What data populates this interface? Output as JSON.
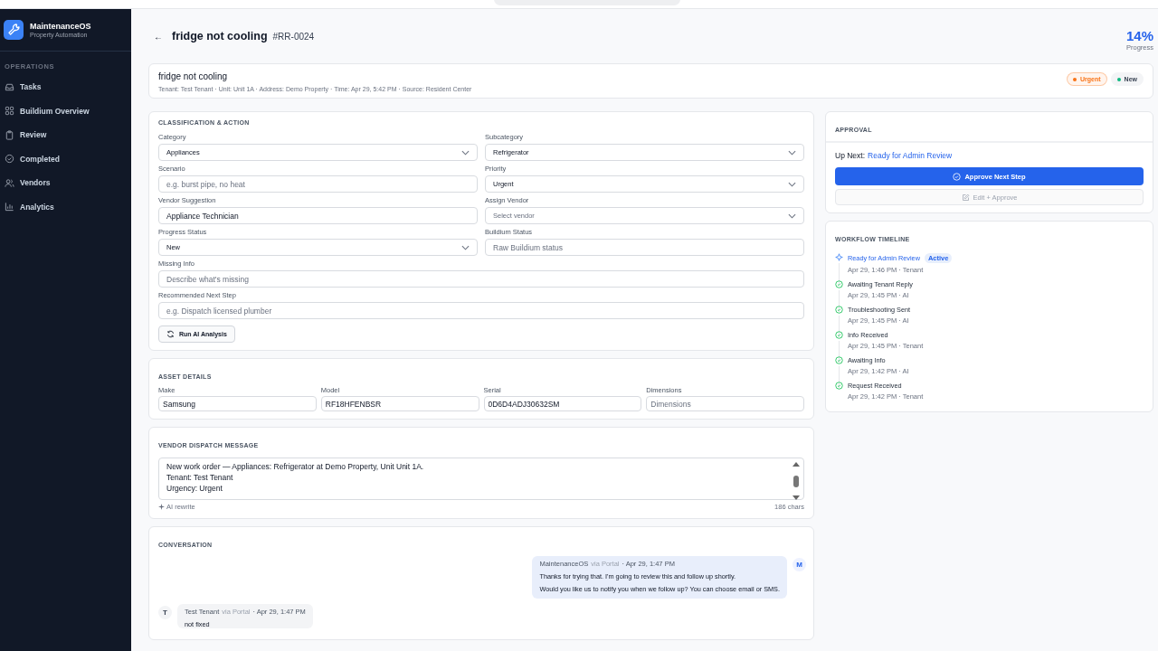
{
  "sidebar": {
    "brand": {
      "name": "MaintenanceOS",
      "subtitle": "Property Automation"
    },
    "section": "OPERATIONS",
    "items": [
      {
        "label": "Tasks",
        "selected": false
      },
      {
        "label": "Buildium Overview",
        "selected": false
      },
      {
        "label": "Review",
        "selected": false
      },
      {
        "label": "Completed",
        "selected": false
      },
      {
        "label": "Vendors",
        "selected": false
      },
      {
        "label": "Analytics",
        "selected": false
      }
    ]
  },
  "header": {
    "back": "←",
    "title": "fridge not cooling",
    "id": "#RR-0024",
    "progress": {
      "value": "14%",
      "label": "Progress"
    }
  },
  "summary": {
    "title": "fridge not cooling",
    "meta": "Tenant: Test Tenant · Unit: Unit 1A · Address: Demo Property · Time: Apr 29, 5:42 PM · Source: Resident Center",
    "badges": [
      {
        "label": "Urgent",
        "color": "#f97316"
      },
      {
        "label": "New",
        "color": "#10b981"
      }
    ]
  },
  "classification": {
    "title": "CLASSIFICATION & ACTION",
    "fields": [
      {
        "label": "Category",
        "kind": "select",
        "value": "Appliances"
      },
      {
        "label": "Subcategory",
        "kind": "select",
        "value": "Refrigerator"
      },
      {
        "label": "Scenario",
        "kind": "input",
        "placeholder": "e.g. burst pipe, no heat"
      },
      {
        "label": "Priority",
        "kind": "select",
        "value": "Urgent"
      },
      {
        "label": "Vendor Suggestion",
        "kind": "input",
        "value": "Appliance Technician"
      },
      {
        "label": "Assign Vendor",
        "kind": "select",
        "placeholder": "Select vendor"
      },
      {
        "label": "Progress Status",
        "kind": "select",
        "value": "New"
      },
      {
        "label": "Buildium Status",
        "kind": "input",
        "placeholder": "Raw Buildium status"
      }
    ],
    "wide_fields": [
      {
        "label": "Missing Info",
        "kind": "input",
        "placeholder": "Describe what's missing"
      },
      {
        "label": "Recommended Next Step",
        "kind": "input",
        "placeholder": "e.g. Dispatch licensed plumber"
      }
    ],
    "button": "Run AI Analysis"
  },
  "asset": {
    "title": "ASSET DETAILS",
    "fields": [
      {
        "label": "Make",
        "value": "Samsung"
      },
      {
        "label": "Model",
        "value": "RF18HFENBSR"
      },
      {
        "label": "Serial",
        "value": "0D6D4ADJ30632SM"
      },
      {
        "label": "Dimensions",
        "placeholder": "Dimensions"
      }
    ]
  },
  "dispatch": {
    "title": "VENDOR DISPATCH MESSAGE",
    "message": "New work order — Appliances: Refrigerator at Demo Property, Unit Unit 1A.\nTenant: Test Tenant\nUrgency: Urgent",
    "rewrite": "AI rewrite",
    "count": "186 chars"
  },
  "conversation": {
    "title": "CONVERSATION",
    "messages": [
      {
        "kind": "outgoing",
        "avatar": "M",
        "author": "MaintenanceOS",
        "via": "via Portal",
        "time": "· Apr 29, 1:47 PM",
        "paragraphs": [
          "Thanks for trying that. I'm going to review this and follow up shortly.",
          "Would you like us to notify you when we follow up? You can choose email or SMS."
        ]
      },
      {
        "kind": "incoming",
        "avatar": "T",
        "author": "Test Tenant",
        "via": "via Portal",
        "time": "· Apr 29, 1:47 PM",
        "paragraphs": [
          "not fixed"
        ]
      }
    ]
  },
  "approval": {
    "title": "APPROVAL",
    "up_next_label": "Up Next:",
    "up_next_value": "Ready for Admin Review",
    "primary": "Approve Next Step",
    "secondary": {
      "label": "Edit + Approve",
      "disabled": true
    }
  },
  "timeline": {
    "title": "WORKFLOW TIMELINE",
    "steps": [
      {
        "title": "Ready for Admin Review",
        "meta": "Apr 29, 1:46 PM · Tenant",
        "active": true,
        "badge": "Active"
      },
      {
        "title": "Awaiting Tenant Reply",
        "meta": "Apr 29, 1:45 PM · AI",
        "active": false
      },
      {
        "title": "Troubleshooting Sent",
        "meta": "Apr 29, 1:45 PM · AI",
        "active": false
      },
      {
        "title": "Info Received",
        "meta": "Apr 29, 1:45 PM · Tenant",
        "active": false
      },
      {
        "title": "Awaiting Info",
        "meta": "Apr 29, 1:42 PM · AI",
        "active": false
      },
      {
        "title": "Request Received",
        "meta": "Apr 29, 1:42 PM · Tenant",
        "active": false
      }
    ]
  }
}
